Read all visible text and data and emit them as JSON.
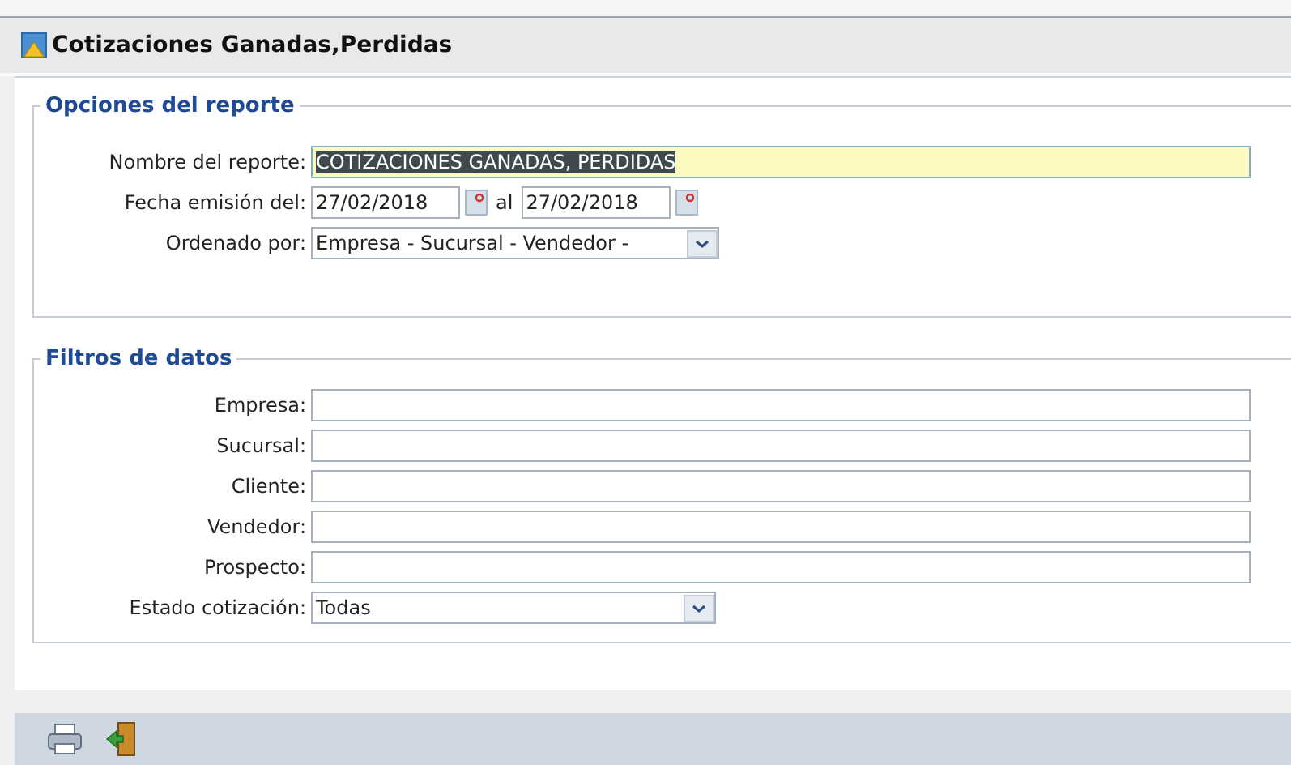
{
  "window": {
    "title": "Cotizaciones Ganadas,Perdidas"
  },
  "report_options": {
    "legend": "Opciones del reporte",
    "rows": [
      {
        "kind": "text",
        "label": "Nombre del reporte:",
        "value": "COTIZACIONES GANADAS, PERDIDAS",
        "selected": true
      },
      {
        "kind": "daterange",
        "label": "Fecha emisión del:",
        "from": "27/02/2018",
        "separator": "al",
        "to": "27/02/2018"
      },
      {
        "kind": "select",
        "label": "Ordenado por:",
        "value": "Empresa - Sucursal - Vendedor -"
      }
    ]
  },
  "data_filters": {
    "legend": "Filtros de datos",
    "rows": [
      {
        "kind": "text",
        "label": "Empresa:"
      },
      {
        "kind": "text",
        "label": "Sucursal:"
      },
      {
        "kind": "text",
        "label": "Cliente:"
      },
      {
        "kind": "text",
        "label": "Vendedor:"
      },
      {
        "kind": "text",
        "label": "Prospecto:"
      },
      {
        "kind": "select",
        "label": "Estado cotización:",
        "value": "Todas"
      }
    ]
  }
}
